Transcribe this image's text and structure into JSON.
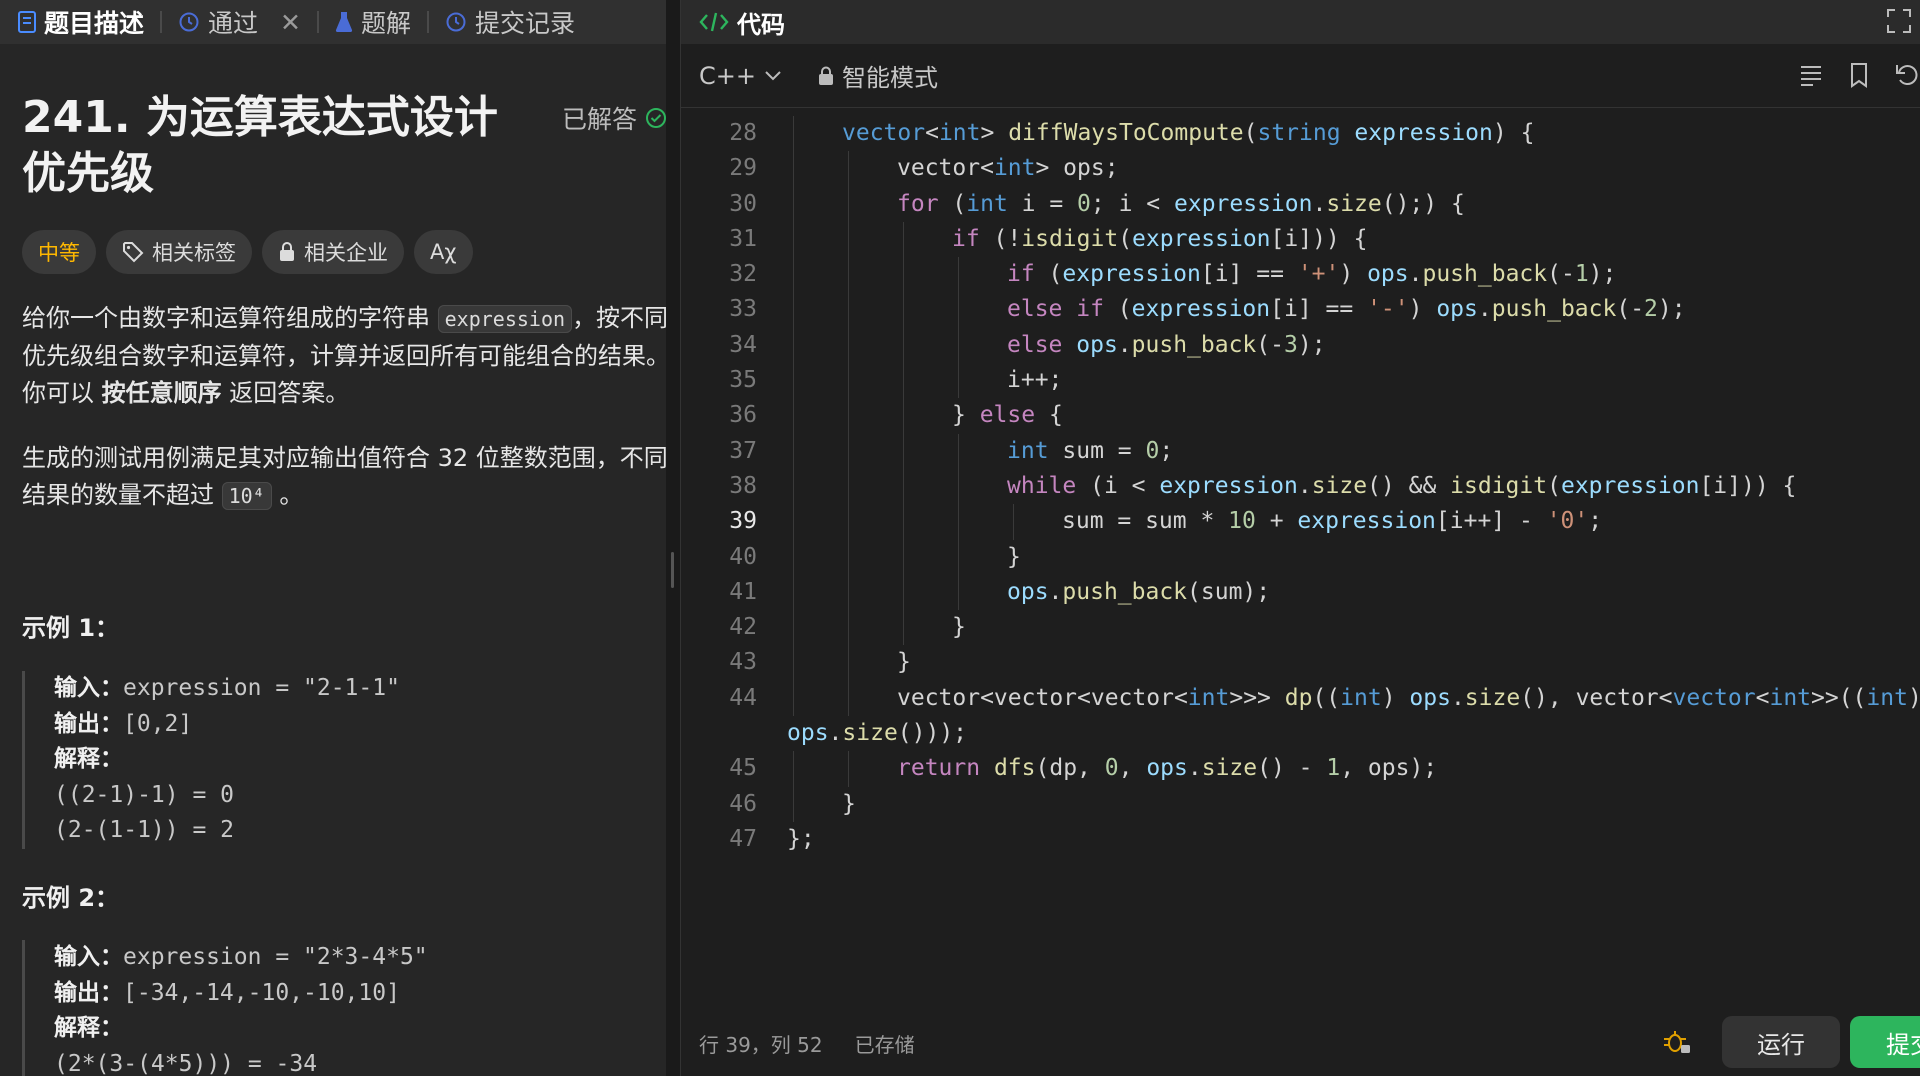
{
  "left_tabs": [
    {
      "label": "题目描述",
      "icon": "document-icon",
      "active": true
    },
    {
      "label": "通过",
      "icon": "history-icon",
      "closable": true
    },
    {
      "label": "题解",
      "icon": "flask-icon"
    },
    {
      "label": "提交记录",
      "icon": "history-icon"
    }
  ],
  "problem": {
    "title": "241. 为运算表达式设计优先级",
    "status": "已解答",
    "difficulty": "中等",
    "tags_label": "相关标签",
    "companies_label": "相关企业",
    "font_label": "Aχ",
    "desc_part1": "给你一个由数字和运算符组成的字符串",
    "desc_code": "expression",
    "desc_part2": "，按不同优先级组合数字和运算符，计算并返回所有可能组合的结果。你可以",
    "desc_bold": "按任意顺序",
    "desc_part3": "返回答案。",
    "desc2_part1": "生成的测试用例满足其对应输出值符合 32 位整数范围，不同结果的数量不超过",
    "desc2_code": "10⁴",
    "desc2_part2": "。"
  },
  "examples": [
    {
      "heading": "示例 1：",
      "input_label": "输入：",
      "input": "expression = \"2-1-1\"",
      "output_label": "输出：",
      "output": "[0,2]",
      "explain_label": "解释：",
      "explain": [
        "((2-1)-1) = 0",
        "(2-(1-1)) = 2"
      ]
    },
    {
      "heading": "示例 2：",
      "input_label": "输入：",
      "input": "expression = \"2*3-4*5\"",
      "output_label": "输出：",
      "output": "[-34,-14,-10,-10,10]",
      "explain_label": "解释：",
      "explain": [
        "(2*(3-(4*5))) = -34"
      ]
    }
  ],
  "code_panel": {
    "title": "代码",
    "language": "C++",
    "mode": "智能模式",
    "cursor": "行 39，列 52",
    "saved": "已存储",
    "run_label": "运行",
    "submit_label": "提交"
  },
  "code_lines": [
    {
      "n": "28",
      "indent": 1,
      "t": [
        [
          "ty",
          "vector"
        ],
        [
          "",
          "<"
        ],
        [
          "ty",
          "int"
        ],
        [
          "",
          "> "
        ],
        [
          "fn",
          "diffWaysToCompute"
        ],
        [
          "",
          "("
        ],
        [
          "ty",
          "string"
        ],
        [
          "",
          ""
        ],
        [
          "id",
          " expression"
        ],
        [
          "",
          ") {"
        ]
      ]
    },
    {
      "n": "29",
      "indent": 2,
      "t": [
        [
          "",
          "vector<"
        ],
        [
          "ty",
          "int"
        ],
        [
          "",
          "> ops;"
        ]
      ]
    },
    {
      "n": "30",
      "indent": 2,
      "t": [
        [
          "kw",
          "for"
        ],
        [
          "",
          " ("
        ],
        [
          "ty",
          "int"
        ],
        [
          "",
          " i = "
        ],
        [
          "nm",
          "0"
        ],
        [
          "",
          "; i < "
        ],
        [
          "id",
          "expression"
        ],
        [
          "",
          "."
        ],
        [
          "fn",
          "size"
        ],
        [
          "",
          "();) {"
        ]
      ]
    },
    {
      "n": "31",
      "indent": 3,
      "t": [
        [
          "kw",
          "if"
        ],
        [
          "",
          " (!"
        ],
        [
          "fn",
          "isdigit"
        ],
        [
          "",
          "("
        ],
        [
          "id",
          "expression"
        ],
        [
          "",
          "[i])) {"
        ]
      ]
    },
    {
      "n": "32",
      "indent": 4,
      "t": [
        [
          "kw",
          "if"
        ],
        [
          "",
          " ("
        ],
        [
          "id",
          "expression"
        ],
        [
          "",
          "[i] == "
        ],
        [
          "st",
          "'+'"
        ],
        [
          "",
          ") "
        ],
        [
          "id",
          "ops"
        ],
        [
          "",
          "."
        ],
        [
          "fn",
          "push_back"
        ],
        [
          "",
          "(-"
        ],
        [
          "nm",
          "1"
        ],
        [
          "",
          ");"
        ]
      ]
    },
    {
      "n": "33",
      "indent": 4,
      "t": [
        [
          "kw",
          "else if"
        ],
        [
          "",
          " ("
        ],
        [
          "id",
          "expression"
        ],
        [
          "",
          "[i] == "
        ],
        [
          "st",
          "'-'"
        ],
        [
          "",
          ") "
        ],
        [
          "id",
          "ops"
        ],
        [
          "",
          "."
        ],
        [
          "fn",
          "push_back"
        ],
        [
          "",
          "(-"
        ],
        [
          "nm",
          "2"
        ],
        [
          "",
          ");"
        ]
      ]
    },
    {
      "n": "34",
      "indent": 4,
      "t": [
        [
          "kw",
          "else"
        ],
        [
          "",
          " "
        ],
        [
          "id",
          "ops"
        ],
        [
          "",
          "."
        ],
        [
          "fn",
          "push_back"
        ],
        [
          "",
          "(-"
        ],
        [
          "nm",
          "3"
        ],
        [
          "",
          ");"
        ]
      ]
    },
    {
      "n": "35",
      "indent": 4,
      "t": [
        [
          "",
          "i++;"
        ]
      ]
    },
    {
      "n": "36",
      "indent": 3,
      "t": [
        [
          "",
          "} "
        ],
        [
          "kw",
          "else"
        ],
        [
          "",
          " {"
        ]
      ]
    },
    {
      "n": "37",
      "indent": 4,
      "t": [
        [
          "ty",
          "int"
        ],
        [
          "",
          " sum = "
        ],
        [
          "nm",
          "0"
        ],
        [
          "",
          ";"
        ]
      ]
    },
    {
      "n": "38",
      "indent": 4,
      "t": [
        [
          "kw",
          "while"
        ],
        [
          "",
          " (i < "
        ],
        [
          "id",
          "expression"
        ],
        [
          "",
          "."
        ],
        [
          "fn",
          "size"
        ],
        [
          "",
          "() && "
        ],
        [
          "fn",
          "isdigit"
        ],
        [
          "",
          "("
        ],
        [
          "id",
          "expression"
        ],
        [
          "",
          "[i])) {"
        ]
      ]
    },
    {
      "n": "39",
      "indent": 5,
      "t": [
        [
          "",
          "sum = sum * "
        ],
        [
          "nm",
          "10"
        ],
        [
          "",
          " + "
        ],
        [
          "id",
          "expression"
        ],
        [
          "",
          "[i++] - "
        ],
        [
          "st",
          "'0'"
        ],
        [
          "",
          ";"
        ]
      ]
    },
    {
      "n": "40",
      "indent": 4,
      "t": [
        [
          "",
          "}"
        ]
      ]
    },
    {
      "n": "41",
      "indent": 4,
      "t": [
        [
          "id",
          "ops"
        ],
        [
          "",
          "."
        ],
        [
          "fn",
          "push_back"
        ],
        [
          "",
          "(sum);"
        ]
      ]
    },
    {
      "n": "42",
      "indent": 3,
      "t": [
        [
          "",
          "}"
        ]
      ]
    },
    {
      "n": "43",
      "indent": 2,
      "t": [
        [
          "",
          "}"
        ]
      ]
    },
    {
      "n": "44",
      "indent": 2,
      "t": [
        [
          "",
          "vector<vector<vector<"
        ],
        [
          "ty",
          "int"
        ],
        [
          "",
          ">>> "
        ],
        [
          "fn",
          "dp"
        ],
        [
          "",
          "(("
        ],
        [
          "ty",
          "int"
        ],
        [
          "",
          ") "
        ],
        [
          "id",
          "ops"
        ],
        [
          "",
          "."
        ],
        [
          "fn",
          "size"
        ],
        [
          "",
          "(), vector<"
        ],
        [
          "ty",
          "vector"
        ],
        [
          "",
          "<"
        ],
        [
          "ty",
          "int"
        ],
        [
          "",
          ">>(("
        ],
        [
          "ty",
          "int"
        ],
        [
          "",
          ")"
        ]
      ]
    },
    {
      "n": "",
      "indent": 0,
      "t": [
        [
          "id",
          "ops"
        ],
        [
          "",
          "."
        ],
        [
          "fn",
          "size"
        ],
        [
          "",
          "()));"
        ]
      ]
    },
    {
      "n": "45",
      "indent": 2,
      "t": [
        [
          "kw",
          "return"
        ],
        [
          "",
          " "
        ],
        [
          "fn",
          "dfs"
        ],
        [
          "",
          "(dp, "
        ],
        [
          "nm",
          "0"
        ],
        [
          "",
          ", "
        ],
        [
          "id",
          "ops"
        ],
        [
          "",
          "."
        ],
        [
          "fn",
          "size"
        ],
        [
          "",
          "() - "
        ],
        [
          "nm",
          "1"
        ],
        [
          "",
          ", ops);"
        ]
      ]
    },
    {
      "n": "46",
      "indent": 1,
      "t": [
        [
          "",
          "}"
        ]
      ]
    },
    {
      "n": "47",
      "indent": 0,
      "t": [
        [
          "",
          "};"
        ]
      ]
    }
  ],
  "current_line": "39"
}
